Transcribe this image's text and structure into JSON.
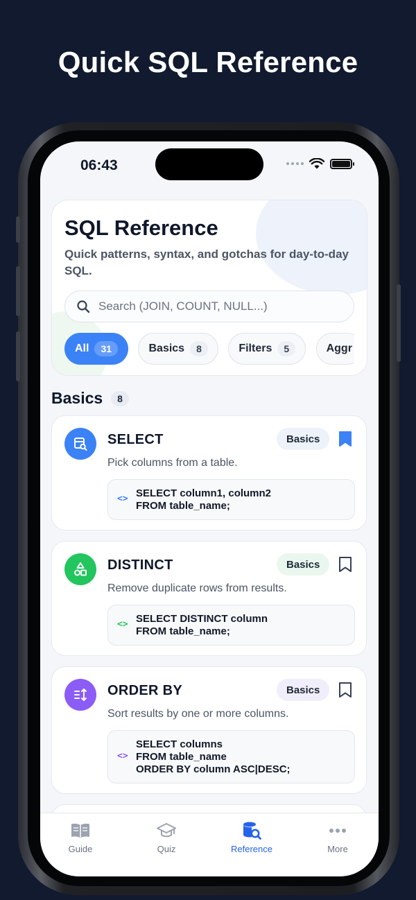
{
  "promo": {
    "title": "Quick SQL Reference"
  },
  "status": {
    "time": "06:43"
  },
  "hero": {
    "title": "SQL Reference",
    "subtitle": "Quick patterns, syntax, and gotchas for day-to-day SQL.",
    "search_placeholder": "Search (JOIN, COUNT, NULL...)"
  },
  "chips": [
    {
      "label": "All",
      "count": "31",
      "active": true
    },
    {
      "label": "Basics",
      "count": "8"
    },
    {
      "label": "Filters",
      "count": "5"
    },
    {
      "label": "Aggr",
      "count": ""
    }
  ],
  "section": {
    "title": "Basics",
    "count": "8"
  },
  "cards": [
    {
      "title": "SELECT",
      "badge": "Basics",
      "description": "Pick columns from a table.",
      "code": [
        "SELECT column1, column2",
        "FROM table_name;"
      ],
      "icon": "table-search-icon",
      "color": "#3b82f6",
      "bookmarked": true
    },
    {
      "title": "DISTINCT",
      "badge": "Basics",
      "description": "Remove duplicate rows from results.",
      "code": [
        "SELECT DISTINCT column",
        "FROM table_name;"
      ],
      "icon": "shapes-icon",
      "color": "#22c55e",
      "bookmarked": false
    },
    {
      "title": "ORDER BY",
      "badge": "Basics",
      "description": "Sort results by one or more columns.",
      "code": [
        "SELECT columns",
        "FROM table_name",
        "ORDER BY column ASC|DESC;"
      ],
      "icon": "sort-icon",
      "color": "#8b5cf6",
      "bookmarked": false
    }
  ],
  "tabs": [
    {
      "label": "Guide",
      "icon": "book-icon"
    },
    {
      "label": "Quiz",
      "icon": "graduation-cap-icon"
    },
    {
      "label": "Reference",
      "icon": "database-search-icon",
      "active": true
    },
    {
      "label": "More",
      "icon": "more-dots-icon"
    }
  ],
  "colors": {
    "accent": "#3b82f6",
    "background": "#111a2e"
  }
}
